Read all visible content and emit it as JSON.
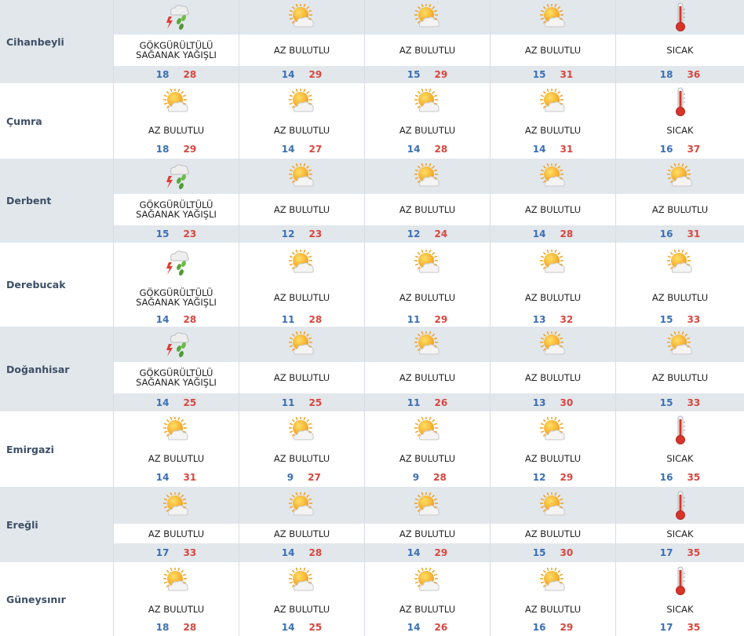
{
  "colors": {
    "min_temp": "#3a6fb5",
    "max_temp": "#d9463e",
    "shaded_band": "#e2e7ec",
    "city_text": "#3d4f66"
  },
  "icons": {
    "storm": "thunderstorm-rain-icon",
    "partly": "partly-cloudy-icon",
    "hot": "thermometer-hot-icon"
  },
  "rows": [
    {
      "city": "Cihanbeyli",
      "days": [
        {
          "icon": "storm",
          "condition": "GÖKGÜRÜLTÜLÜ SAĞANAK YAĞIŞLI",
          "min": "18",
          "max": "28"
        },
        {
          "icon": "partly",
          "condition": "AZ BULUTLU",
          "min": "14",
          "max": "29"
        },
        {
          "icon": "partly",
          "condition": "AZ BULUTLU",
          "min": "15",
          "max": "29"
        },
        {
          "icon": "partly",
          "condition": "AZ BULUTLU",
          "min": "15",
          "max": "31"
        },
        {
          "icon": "hot",
          "condition": "SICAK",
          "min": "18",
          "max": "36"
        }
      ]
    },
    {
      "city": "Çumra",
      "days": [
        {
          "icon": "partly",
          "condition": "AZ BULUTLU",
          "min": "18",
          "max": "29"
        },
        {
          "icon": "partly",
          "condition": "AZ BULUTLU",
          "min": "14",
          "max": "27"
        },
        {
          "icon": "partly",
          "condition": "AZ BULUTLU",
          "min": "14",
          "max": "28"
        },
        {
          "icon": "partly",
          "condition": "AZ BULUTLU",
          "min": "14",
          "max": "31"
        },
        {
          "icon": "hot",
          "condition": "SICAK",
          "min": "16",
          "max": "37"
        }
      ]
    },
    {
      "city": "Derbent",
      "days": [
        {
          "icon": "storm",
          "condition": "GÖKGÜRÜLTÜLÜ SAĞANAK YAĞIŞLI",
          "min": "15",
          "max": "23"
        },
        {
          "icon": "partly",
          "condition": "AZ BULUTLU",
          "min": "12",
          "max": "23"
        },
        {
          "icon": "partly",
          "condition": "AZ BULUTLU",
          "min": "12",
          "max": "24"
        },
        {
          "icon": "partly",
          "condition": "AZ BULUTLU",
          "min": "14",
          "max": "28"
        },
        {
          "icon": "partly",
          "condition": "AZ BULUTLU",
          "min": "16",
          "max": "31"
        }
      ]
    },
    {
      "city": "Derebucak",
      "days": [
        {
          "icon": "storm",
          "condition": "GÖKGÜRÜLTÜLÜ SAĞANAK YAĞIŞLI",
          "min": "14",
          "max": "28"
        },
        {
          "icon": "partly",
          "condition": "AZ BULUTLU",
          "min": "11",
          "max": "28"
        },
        {
          "icon": "partly",
          "condition": "AZ BULUTLU",
          "min": "11",
          "max": "29"
        },
        {
          "icon": "partly",
          "condition": "AZ BULUTLU",
          "min": "13",
          "max": "32"
        },
        {
          "icon": "partly",
          "condition": "AZ BULUTLU",
          "min": "15",
          "max": "33"
        }
      ]
    },
    {
      "city": "Doğanhisar",
      "days": [
        {
          "icon": "storm",
          "condition": "GÖKGÜRÜLTÜLÜ SAĞANAK YAĞIŞLI",
          "min": "14",
          "max": "25"
        },
        {
          "icon": "partly",
          "condition": "AZ BULUTLU",
          "min": "11",
          "max": "25"
        },
        {
          "icon": "partly",
          "condition": "AZ BULUTLU",
          "min": "11",
          "max": "26"
        },
        {
          "icon": "partly",
          "condition": "AZ BULUTLU",
          "min": "13",
          "max": "30"
        },
        {
          "icon": "partly",
          "condition": "AZ BULUTLU",
          "min": "15",
          "max": "33"
        }
      ]
    },
    {
      "city": "Emirgazi",
      "days": [
        {
          "icon": "partly",
          "condition": "AZ BULUTLU",
          "min": "14",
          "max": "31"
        },
        {
          "icon": "partly",
          "condition": "AZ BULUTLU",
          "min": "9",
          "max": "27"
        },
        {
          "icon": "partly",
          "condition": "AZ BULUTLU",
          "min": "9",
          "max": "28"
        },
        {
          "icon": "partly",
          "condition": "AZ BULUTLU",
          "min": "12",
          "max": "29"
        },
        {
          "icon": "hot",
          "condition": "SICAK",
          "min": "16",
          "max": "35"
        }
      ]
    },
    {
      "city": "Ereğli",
      "days": [
        {
          "icon": "partly",
          "condition": "AZ BULUTLU",
          "min": "17",
          "max": "33"
        },
        {
          "icon": "partly",
          "condition": "AZ BULUTLU",
          "min": "14",
          "max": "28"
        },
        {
          "icon": "partly",
          "condition": "AZ BULUTLU",
          "min": "14",
          "max": "29"
        },
        {
          "icon": "partly",
          "condition": "AZ BULUTLU",
          "min": "15",
          "max": "30"
        },
        {
          "icon": "hot",
          "condition": "SICAK",
          "min": "17",
          "max": "35"
        }
      ]
    },
    {
      "city": "Güneysınır",
      "days": [
        {
          "icon": "partly",
          "condition": "AZ BULUTLU",
          "min": "18",
          "max": "28"
        },
        {
          "icon": "partly",
          "condition": "AZ BULUTLU",
          "min": "14",
          "max": "25"
        },
        {
          "icon": "partly",
          "condition": "AZ BULUTLU",
          "min": "14",
          "max": "26"
        },
        {
          "icon": "partly",
          "condition": "AZ BULUTLU",
          "min": "16",
          "max": "29"
        },
        {
          "icon": "hot",
          "condition": "SICAK",
          "min": "17",
          "max": "35"
        }
      ]
    }
  ]
}
